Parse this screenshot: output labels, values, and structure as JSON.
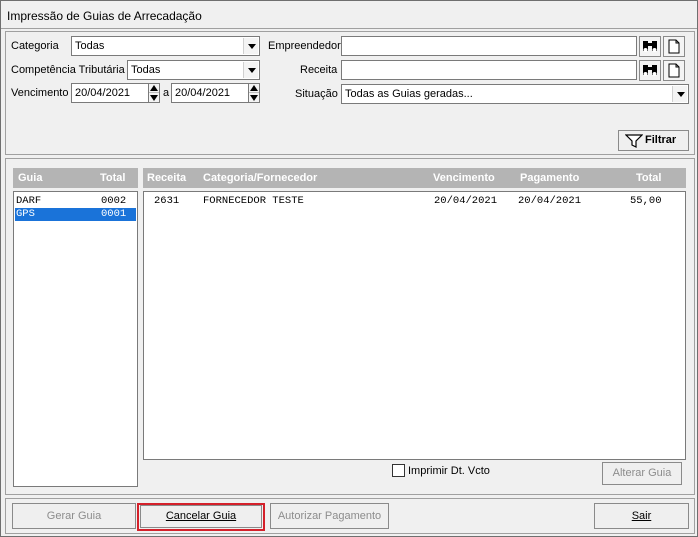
{
  "window": {
    "title": "Impressão de Guias de Arrecadação"
  },
  "filters": {
    "categoria_label": "Categoria",
    "categoria_value": "Todas",
    "competencia_label": "Competência Tributária",
    "competencia_value": "Todas",
    "vencimento_label": "Vencimento",
    "vencimento_from": "20/04/2021",
    "vencimento_sep": "a",
    "vencimento_to": "20/04/2021",
    "empreendedor_label": "Empreendedor",
    "empreendedor_value": "",
    "receita_label": "Receita",
    "receita_value": "",
    "situacao_label": "Situação",
    "situacao_value": "Todas as Guias geradas...",
    "filtrar_label": "Filtrar"
  },
  "guias": {
    "headers": {
      "guia": "Guia",
      "total": "Total"
    },
    "rows": [
      {
        "guia": "DARF",
        "total": "0002",
        "selected": false
      },
      {
        "guia": "GPS",
        "total": "0001",
        "selected": true
      }
    ]
  },
  "detalhe": {
    "headers": {
      "receita": "Receita",
      "categoria": "Categoria/Fornecedor",
      "vencimento": "Vencimento",
      "pagamento": "Pagamento",
      "total": "Total"
    },
    "rows": [
      {
        "receita": "2631",
        "categoria": "FORNECEDOR TESTE",
        "vencimento": "20/04/2021",
        "pagamento": "20/04/2021",
        "total": "55,00"
      }
    ]
  },
  "options": {
    "imprimir_label": "Imprimir Dt. Vcto",
    "imprimir_checked": false,
    "alterar_label": "Alterar Guia"
  },
  "actions": {
    "gerar_label": "Gerar Guia",
    "cancelar_label": "Cancelar Guia",
    "autorizar_label": "Autorizar Pagamento",
    "sair_label": "Sair"
  },
  "colors": {
    "selection": "#1a73d9",
    "highlight": "#d4202a",
    "header_bg": "#b4b4b4"
  }
}
